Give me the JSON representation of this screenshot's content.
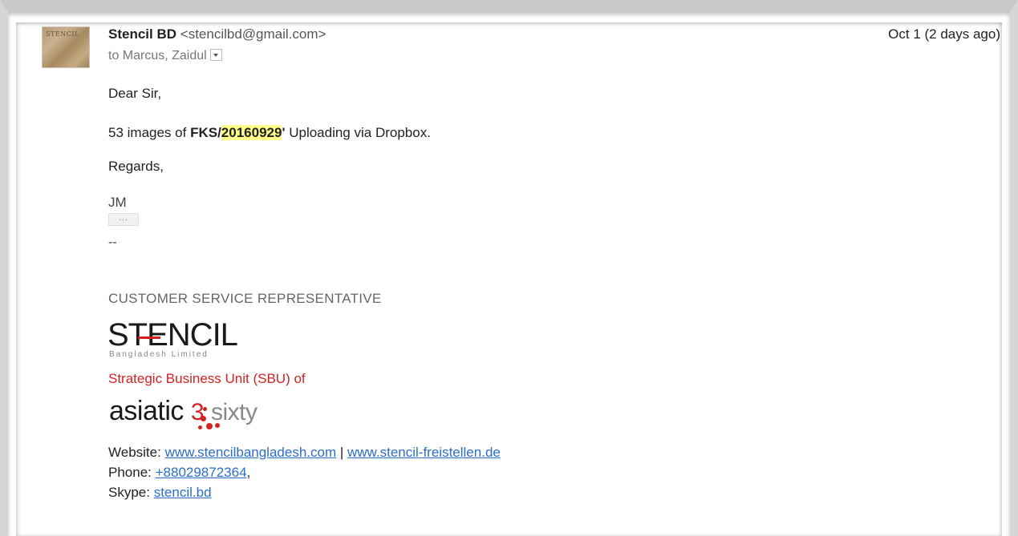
{
  "email": {
    "sender_name": "Stencil BD",
    "sender_email": "<stencilbd@gmail.com>",
    "date": "Oct 1 (2 days ago)",
    "recipients": "to Marcus, Zaidul",
    "avatar_text": "STENCIL",
    "greeting": "Dear Sir,",
    "line1_prefix": "53 images of ",
    "line1_bold": "FKS/",
    "line1_highlight": "20160929",
    "line1_quote": "'",
    "line1_suffix": " Uploading via Dropbox.",
    "regards": "Regards,",
    "initials": "JM",
    "ellipsis": "...",
    "separator": "--"
  },
  "signature": {
    "title": "CUSTOMER SERVICE REPRESENTATIVE",
    "logo_text": "STENCIL",
    "logo_sub": "Bangladesh Limited",
    "sbu": "Strategic Business Unit (SBU) of",
    "asiatic_word": "asiatic",
    "asiatic_num": "3",
    "asiatic_sixty": "sixty",
    "website_label": "Website: ",
    "website1": "www.stencilbangladesh.com",
    "website_sep": " | ",
    "website2": "www.stencil-freistellen.de",
    "phone_label": "Phone: ",
    "phone": "+88029872364",
    "phone_suffix": ",",
    "skype_label": "Skype: ",
    "skype": "stencil.bd"
  },
  "colors": {
    "accent_red": "#d32222",
    "link_blue": "#2a6ec9",
    "highlight": "#ffff8a"
  }
}
